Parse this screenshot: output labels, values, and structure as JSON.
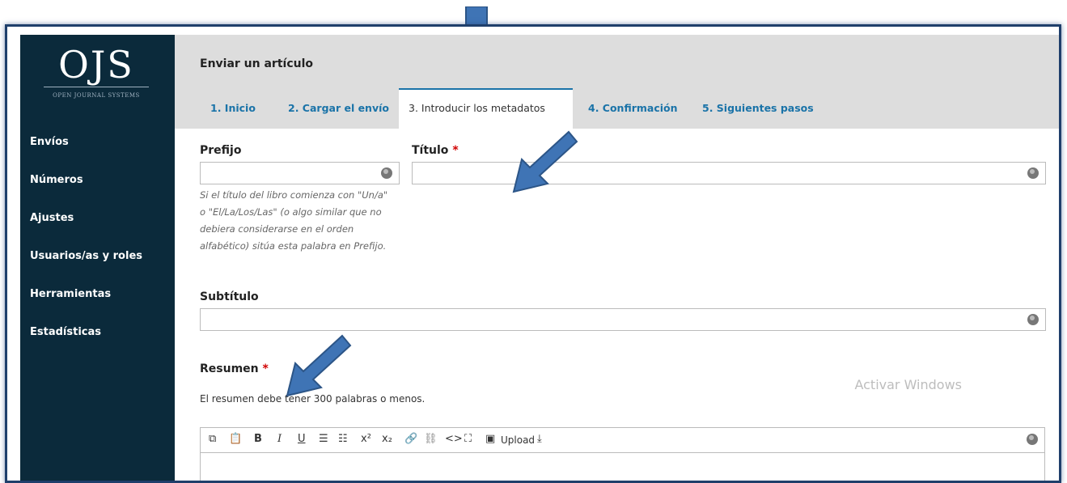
{
  "logo": {
    "main": "OJS",
    "sub": "OPEN JOURNAL SYSTEMS"
  },
  "nav": [
    "Envíos",
    "Números",
    "Ajustes",
    "Usuarios/as y roles",
    "Herramientas",
    "Estadísticas"
  ],
  "header": {
    "title": "Enviar un artículo",
    "tabs": [
      "1. Inicio",
      "2. Cargar el envío",
      "3. Introducir los metadatos",
      "4. Confirmación",
      "5. Siguientes pasos"
    ],
    "active_tab": 2
  },
  "form": {
    "prefix_label": "Prefijo",
    "title_label": "Título",
    "required_mark": "*",
    "prefix_hint": [
      "Si el título del libro comienza con \"Un/a\"",
      "o \"El/La/Los/Las\" (o algo similar que no",
      "debiera considerarse en el orden",
      "alfabético) sitúa esta palabra en Prefijo."
    ],
    "subtitle_label": "Subtítulo",
    "abstract_label": "Resumen",
    "abstract_help": "El resumen debe tener 300 palabras o menos.",
    "upload_label": "Upload",
    "toolbar_icons": [
      "copy-icon",
      "paste-icon",
      "bold-icon",
      "italic-icon",
      "underline-icon",
      "bullet-list-icon",
      "numbered-list-icon",
      "superscript-icon",
      "subscript-icon",
      "link-icon",
      "unlink-icon",
      "code-icon",
      "fullscreen-icon",
      "image-icon",
      "upload-icon",
      "download-icon"
    ]
  },
  "watermark": "Activar Windows",
  "colors": {
    "sidebar": "#0b2a3b",
    "accent": "#1a73a8",
    "required": "#d00000",
    "arrow": "#3f74b5"
  }
}
